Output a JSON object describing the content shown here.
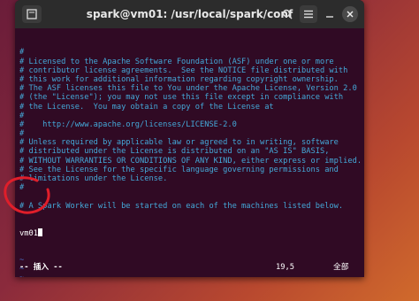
{
  "window": {
    "title": "spark@vm01: /usr/local/spark/conf"
  },
  "icons": {
    "new_tab": "new-tab-icon",
    "search": "search-icon",
    "menu": "hamburger-menu-icon",
    "minimize": "minimize-icon",
    "close": "close-icon"
  },
  "editor": {
    "lines": [
      "#",
      "# Licensed to the Apache Software Foundation (ASF) under one or more",
      "# contributor license agreements.  See the NOTICE file distributed with",
      "# this work for additional information regarding copyright ownership.",
      "# The ASF licenses this file to You under the Apache License, Version 2.0",
      "# (the \"License\"); you may not use this file except in compliance with",
      "# the License.  You may obtain a copy of the License at",
      "#",
      "#    http://www.apache.org/licenses/LICENSE-2.0",
      "#",
      "# Unless required by applicable law or agreed to in writing, software",
      "# distributed under the License is distributed on an \"AS IS\" BASIS,",
      "# WITHOUT WARRANTIES OR CONDITIONS OF ANY KIND, either express or implied.",
      "# See the License for the specific language governing permissions and",
      "# limitations under the License.",
      "#",
      "",
      "# A Spark Worker will be started on each of the machines listed below."
    ],
    "current_line": "vm01",
    "tilde": "~",
    "tilde_count": 6
  },
  "status": {
    "mode": "-- 插入 --",
    "position": "19,5",
    "scroll": "全部"
  },
  "colors": {
    "terminal_bg": "#300a24",
    "comment": "#44a8d8",
    "annotation": "#e01e2a"
  }
}
